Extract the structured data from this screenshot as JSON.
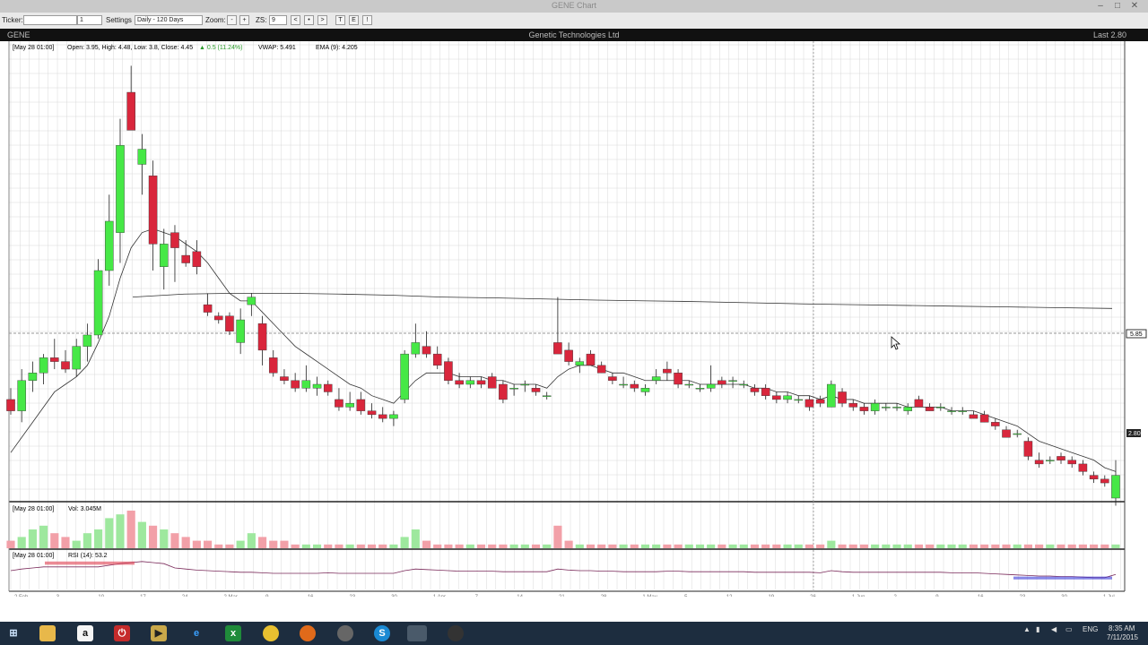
{
  "window": {
    "title": "GENE Chart",
    "min": "–",
    "max": "□",
    "close": "✕"
  },
  "toolbar": {
    "ticker_label": "Ticker:",
    "ticker_value": "",
    "ticker_count": "1",
    "settings_label": "Settings",
    "settings_value": "Daily - 120 Days",
    "zoom_label": "Zoom:",
    "zoom_out": "-",
    "zoom_in": "+",
    "zs_label": "ZS:",
    "zs_value": "9",
    "nav": [
      "<",
      "•",
      ">"
    ],
    "tools": [
      "T",
      "E",
      "!"
    ]
  },
  "header": {
    "symbol": "GENE",
    "center": "Genetic Technologies Ltd",
    "right": "Last 2.80"
  },
  "price_info": {
    "date": "[May 28 01:00]",
    "ohlc": "Open: 3.95, High: 4.48, Low: 3.8, Close: 4.45",
    "change": "▲ 0.5 (11.24%)",
    "vwap": "VWAP: 5.491",
    "ema": "EMA (9): 4.205",
    "right_labels": [
      "5.85",
      "2.80"
    ]
  },
  "volume_info": {
    "date": "[May 28 01:00]",
    "label": "Vol: 3.045M"
  },
  "rsi_info": {
    "date": "[May 28 01:00]",
    "label": "RSI (14): 53.2"
  },
  "xaxis_labels": [
    "2 Feb",
    "3",
    "10",
    "17",
    "24",
    "2 Mar",
    "9",
    "16",
    "23",
    "30",
    "1 Apr",
    "7",
    "14",
    "21",
    "28",
    "1 May",
    "5",
    "12",
    "19",
    "26",
    "1 Jun",
    "2",
    "9",
    "16",
    "23",
    "30",
    "1 Jul"
  ],
  "colors": {
    "up": "#46e846",
    "down": "#d9263c",
    "grid": "#d8d8d8",
    "line": "#333333",
    "rsi_low": "#3a3ad8",
    "rsi_high": "#e03e4e"
  },
  "chart_data": {
    "type": "candlestick",
    "title": "GENE",
    "series": [
      {
        "name": "price",
        "candles": [
          [
            6.6,
            6.9,
            6.2,
            6.3
          ],
          [
            6.3,
            7.4,
            6.0,
            7.1
          ],
          [
            7.1,
            7.6,
            6.8,
            7.3
          ],
          [
            7.3,
            7.8,
            7.0,
            7.7
          ],
          [
            7.7,
            8.2,
            7.4,
            7.6
          ],
          [
            7.6,
            7.9,
            7.3,
            7.4
          ],
          [
            7.4,
            8.2,
            7.2,
            8.0
          ],
          [
            8.0,
            8.6,
            7.6,
            8.3
          ],
          [
            8.3,
            10.3,
            8.2,
            10.0
          ],
          [
            10.0,
            12.0,
            9.6,
            11.3
          ],
          [
            11.0,
            14.0,
            10.2,
            13.3
          ],
          [
            14.7,
            15.4,
            14.0,
            13.7
          ],
          [
            12.8,
            13.6,
            12.0,
            13.2
          ],
          [
            12.5,
            12.9,
            10.0,
            10.7
          ],
          [
            10.1,
            11.1,
            9.5,
            10.7
          ],
          [
            11.0,
            11.2,
            9.7,
            10.6
          ],
          [
            10.4,
            10.8,
            10.1,
            10.2
          ],
          [
            10.5,
            10.8,
            9.9,
            10.1
          ],
          [
            9.1,
            9.4,
            8.8,
            8.9
          ],
          [
            8.8,
            8.9,
            8.6,
            8.7
          ],
          [
            8.8,
            8.9,
            8.3,
            8.4
          ],
          [
            8.1,
            9.0,
            7.8,
            8.7
          ],
          [
            9.1,
            9.4,
            8.8,
            9.3
          ],
          [
            8.6,
            8.8,
            7.5,
            7.9
          ],
          [
            7.7,
            7.9,
            7.2,
            7.3
          ],
          [
            7.2,
            7.4,
            7.0,
            7.1
          ],
          [
            7.1,
            7.3,
            6.8,
            6.9
          ],
          [
            6.9,
            7.5,
            6.8,
            7.1
          ],
          [
            6.9,
            7.2,
            6.7,
            7.0
          ],
          [
            7.0,
            7.1,
            6.7,
            6.8
          ],
          [
            6.6,
            6.9,
            6.3,
            6.4
          ],
          [
            6.4,
            6.8,
            6.3,
            6.5
          ],
          [
            6.6,
            6.8,
            6.2,
            6.3
          ],
          [
            6.3,
            6.5,
            6.1,
            6.2
          ],
          [
            6.2,
            6.4,
            6.0,
            6.1
          ],
          [
            6.1,
            6.3,
            5.9,
            6.2
          ],
          [
            6.6,
            7.9,
            6.5,
            7.8
          ],
          [
            7.8,
            8.6,
            7.7,
            8.1
          ],
          [
            8.0,
            8.4,
            7.7,
            7.8
          ],
          [
            7.8,
            8.0,
            7.4,
            7.5
          ],
          [
            7.6,
            7.7,
            7.0,
            7.1
          ],
          [
            7.1,
            7.3,
            6.9,
            7.0
          ],
          [
            7.0,
            7.2,
            6.9,
            7.1
          ],
          [
            7.1,
            7.2,
            6.9,
            7.0
          ],
          [
            7.2,
            7.3,
            6.9,
            6.9
          ],
          [
            7.0,
            7.1,
            6.5,
            6.6
          ],
          [
            6.9,
            7.0,
            6.7,
            6.9
          ],
          [
            7.0,
            7.1,
            6.8,
            7.0
          ],
          [
            6.9,
            7.0,
            6.7,
            6.8
          ],
          [
            6.7,
            6.8,
            6.6,
            6.7
          ],
          [
            8.1,
            9.3,
            8.0,
            7.8
          ],
          [
            7.9,
            8.1,
            7.5,
            7.6
          ],
          [
            7.5,
            7.7,
            7.3,
            7.6
          ],
          [
            7.8,
            7.9,
            7.5,
            7.5
          ],
          [
            7.5,
            7.6,
            7.3,
            7.3
          ],
          [
            7.2,
            7.3,
            7.0,
            7.1
          ],
          [
            7.0,
            7.2,
            6.9,
            7.0
          ],
          [
            7.0,
            7.1,
            6.8,
            6.9
          ],
          [
            6.8,
            7.0,
            6.7,
            6.9
          ],
          [
            7.1,
            7.4,
            7.0,
            7.2
          ],
          [
            7.4,
            7.6,
            7.1,
            7.3
          ],
          [
            7.3,
            7.4,
            6.9,
            7.0
          ],
          [
            7.0,
            7.1,
            6.9,
            7.0
          ],
          [
            6.9,
            7.0,
            6.8,
            6.9
          ],
          [
            6.9,
            7.5,
            6.8,
            7.0
          ],
          [
            7.1,
            7.2,
            6.9,
            7.0
          ],
          [
            7.1,
            7.2,
            6.9,
            7.1
          ],
          [
            7.0,
            7.1,
            6.9,
            7.0
          ],
          [
            6.9,
            7.0,
            6.7,
            6.8
          ],
          [
            6.9,
            7.0,
            6.6,
            6.7
          ],
          [
            6.7,
            6.8,
            6.5,
            6.6
          ],
          [
            6.6,
            6.8,
            6.5,
            6.7
          ],
          [
            6.6,
            6.7,
            6.5,
            6.6
          ],
          [
            6.6,
            6.7,
            6.3,
            6.4
          ],
          [
            6.6,
            6.7,
            6.4,
            6.5
          ],
          [
            6.4,
            7.1,
            6.4,
            7.0
          ],
          [
            6.8,
            6.9,
            6.4,
            6.5
          ],
          [
            6.5,
            6.6,
            6.3,
            6.4
          ],
          [
            6.4,
            6.5,
            6.2,
            6.3
          ],
          [
            6.3,
            6.6,
            6.2,
            6.5
          ],
          [
            6.4,
            6.5,
            6.3,
            6.4
          ],
          [
            6.4,
            6.5,
            6.3,
            6.4
          ],
          [
            6.3,
            6.5,
            6.2,
            6.4
          ],
          [
            6.6,
            6.7,
            6.4,
            6.4
          ],
          [
            6.4,
            6.5,
            6.3,
            6.3
          ],
          [
            6.4,
            6.5,
            6.3,
            6.4
          ],
          [
            6.3,
            6.4,
            6.2,
            6.3
          ],
          [
            6.3,
            6.4,
            6.2,
            6.3
          ],
          [
            6.2,
            6.3,
            6.1,
            6.1
          ],
          [
            6.2,
            6.3,
            6.0,
            6.0
          ],
          [
            6.0,
            6.1,
            5.8,
            5.9
          ],
          [
            5.8,
            5.9,
            5.6,
            5.6
          ],
          [
            5.7,
            5.8,
            5.6,
            5.7
          ],
          [
            5.5,
            5.6,
            5.0,
            5.1
          ],
          [
            5.0,
            5.2,
            4.8,
            4.9
          ],
          [
            5.0,
            5.1,
            4.9,
            5.0
          ],
          [
            5.1,
            5.2,
            4.9,
            5.0
          ],
          [
            5.0,
            5.1,
            4.8,
            4.9
          ],
          [
            4.9,
            5.0,
            4.6,
            4.7
          ],
          [
            4.6,
            4.7,
            4.4,
            4.5
          ],
          [
            4.5,
            4.6,
            4.3,
            4.4
          ],
          [
            4.0,
            5.0,
            3.8,
            4.6
          ]
        ]
      },
      {
        "name": "EMA (9)",
        "values": [
          5.2,
          5.6,
          6.0,
          6.4,
          6.8,
          7.0,
          7.2,
          7.5,
          8.1,
          8.8,
          9.8,
          10.6,
          11.0,
          11.1,
          11.0,
          10.9,
          10.7,
          10.5,
          10.2,
          9.8,
          9.4,
          9.2,
          9.2,
          8.9,
          8.6,
          8.3,
          8.0,
          7.8,
          7.6,
          7.4,
          7.2,
          7.0,
          6.9,
          6.7,
          6.6,
          6.5,
          6.8,
          7.1,
          7.3,
          7.3,
          7.3,
          7.2,
          7.2,
          7.2,
          7.1,
          7.1,
          7.0,
          7.0,
          7.0,
          6.9,
          7.2,
          7.4,
          7.5,
          7.5,
          7.4,
          7.3,
          7.3,
          7.2,
          7.1,
          7.1,
          7.1,
          7.1,
          7.1,
          7.0,
          7.0,
          7.0,
          7.0,
          7.0,
          6.9,
          6.9,
          6.8,
          6.8,
          6.7,
          6.7,
          6.6,
          6.7,
          6.6,
          6.6,
          6.5,
          6.5,
          6.5,
          6.5,
          6.4,
          6.4,
          6.4,
          6.4,
          6.3,
          6.3,
          6.3,
          6.2,
          6.1,
          6.0,
          5.9,
          5.7,
          5.5,
          5.4,
          5.3,
          5.2,
          5.1,
          5.0,
          4.8,
          4.7
        ]
      },
      {
        "name": "VWAP",
        "values": [
          9.3,
          9.38,
          9.4,
          9.4,
          9.38,
          9.35,
          9.3,
          9.28,
          9.25,
          9.22,
          9.2,
          9.18,
          9.15,
          9.12,
          9.1,
          9.08,
          9.06,
          9.04,
          9.02,
          9.0
        ]
      }
    ],
    "price_ylim": [
      4.0,
      16.0
    ],
    "volume": [
      0.2,
      0.3,
      0.5,
      0.6,
      0.4,
      0.3,
      0.2,
      0.4,
      0.5,
      0.8,
      0.9,
      1.0,
      0.7,
      0.6,
      0.5,
      0.4,
      0.3,
      0.2,
      0.2,
      0.1,
      0.1,
      0.2,
      0.4,
      0.3,
      0.2,
      0.2,
      0.1,
      0.1,
      0.1,
      0.1,
      0.1,
      0.1,
      0.1,
      0.1,
      0.1,
      0.1,
      0.3,
      0.5,
      0.2,
      0.1,
      0.1,
      0.1,
      0.1,
      0.1,
      0.1,
      0.1,
      0.1,
      0.1,
      0.1,
      0.1,
      0.6,
      0.2,
      0.1,
      0.1,
      0.1,
      0.1,
      0.1,
      0.1,
      0.1,
      0.1,
      0.1,
      0.1,
      0.1,
      0.1,
      0.1,
      0.1,
      0.1,
      0.1,
      0.1,
      0.1,
      0.1,
      0.1,
      0.1,
      0.1,
      0.1,
      0.2,
      0.1,
      0.1,
      0.1,
      0.1,
      0.1,
      0.1,
      0.1,
      0.1,
      0.1,
      0.1,
      0.1,
      0.1,
      0.1,
      0.1,
      0.1,
      0.1,
      0.1,
      0.1,
      0.1,
      0.1,
      0.1,
      0.1,
      0.1,
      0.1,
      0.1,
      0.1
    ],
    "rsi": [
      55,
      58,
      60,
      62,
      62,
      62,
      62,
      62,
      62,
      65,
      68,
      70,
      72,
      70,
      68,
      60,
      58,
      56,
      55,
      54,
      53,
      52,
      52,
      51,
      50,
      50,
      50,
      50,
      50,
      51,
      50,
      50,
      50,
      50,
      50,
      50,
      55,
      58,
      57,
      56,
      55,
      54,
      54,
      54,
      54,
      53,
      53,
      53,
      53,
      53,
      58,
      56,
      55,
      55,
      54,
      54,
      53,
      53,
      53,
      53,
      54,
      54,
      53,
      53,
      53,
      53,
      53,
      53,
      52,
      52,
      52,
      52,
      52,
      52,
      51,
      55,
      53,
      52,
      52,
      52,
      52,
      52,
      52,
      52,
      52,
      52,
      51,
      51,
      51,
      50,
      49,
      48,
      47,
      46,
      45,
      45,
      44,
      44,
      43,
      42,
      42,
      48
    ],
    "ylim_rsi": [
      20,
      90
    ]
  }
}
